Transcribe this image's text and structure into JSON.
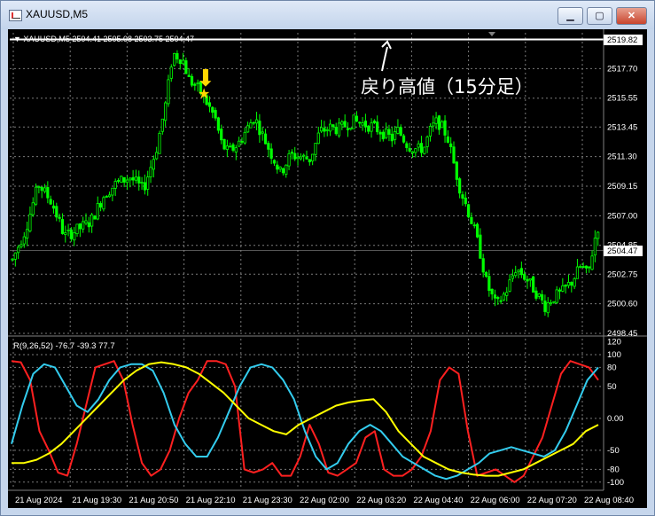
{
  "window": {
    "title": "XAUUSD,M5",
    "icon": "chart-window-icon",
    "minimize_label": "▁",
    "maximize_label": "▢",
    "close_label": "✕"
  },
  "chart_data": [
    {
      "type": "candlestick",
      "header": "▼ XAUUSD,M5  2504.41 2505.08 2503.75 2504.47",
      "symbol": "XAUUSD,M5",
      "ohlc": {
        "open": 2504.41,
        "high": 2505.08,
        "low": 2503.75,
        "close": 2504.47
      },
      "y_ticks": [
        "2517.70",
        "2515.55",
        "2513.45",
        "2511.30",
        "2509.15",
        "2507.00",
        "2504.85",
        "2502.75",
        "2500.60",
        "2498.45"
      ],
      "ylim": [
        2498.45,
        2520.3
      ],
      "x_ticks": [
        "21 Aug 2024",
        "21 Aug 19:30",
        "21 Aug 20:50",
        "21 Aug 22:10",
        "21 Aug 23:30",
        "22 Aug 02:00",
        "22 Aug 03:20",
        "22 Aug 04:40",
        "22 Aug 06:00",
        "22 Aug 07:20",
        "22 Aug 08:40"
      ],
      "grid": true,
      "bull_color": "#00ff00",
      "bear_color": "#00ff00",
      "background": "#000000",
      "close_path": [
        [
          0,
          2503.8
        ],
        [
          4,
          2506
        ],
        [
          8,
          2509.3
        ],
        [
          12,
          2508
        ],
        [
          16,
          2505.5
        ],
        [
          20,
          2506
        ],
        [
          24,
          2506.6
        ],
        [
          28,
          2508.5
        ],
        [
          32,
          2509.4
        ],
        [
          36,
          2509.8
        ],
        [
          40,
          2508.9
        ],
        [
          44,
          2511.8
        ],
        [
          47,
          2515.3
        ],
        [
          49,
          2518.8
        ],
        [
          52,
          2518.4
        ],
        [
          54,
          2516.9
        ],
        [
          57,
          2516.2
        ],
        [
          59,
          2515.4
        ],
        [
          62,
          2514.1
        ],
        [
          64,
          2512.2
        ],
        [
          66,
          2511.6
        ],
        [
          69,
          2512.2
        ],
        [
          72,
          2513.4
        ],
        [
          74,
          2514.2
        ],
        [
          77,
          2512.6
        ],
        [
          80,
          2511.1
        ],
        [
          82,
          2510.1
        ],
        [
          85,
          2511.4
        ],
        [
          88,
          2511.3
        ],
        [
          91,
          2511.1
        ],
        [
          94,
          2513.1
        ],
        [
          97,
          2513.4
        ],
        [
          100,
          2513.3
        ],
        [
          104,
          2513.9
        ],
        [
          107,
          2513.7
        ],
        [
          110,
          2513.5
        ],
        [
          113,
          2513.1
        ],
        [
          116,
          2512.6
        ],
        [
          118,
          2513.2
        ],
        [
          121,
          2512.1
        ],
        [
          124,
          2511.8
        ],
        [
          126,
          2512.0
        ],
        [
          128,
          2513.3
        ],
        [
          130,
          2513.9
        ],
        [
          133,
          2512.8
        ],
        [
          135,
          2510.8
        ],
        [
          137,
          2508.9
        ],
        [
          139,
          2507.6
        ],
        [
          141,
          2506.2
        ],
        [
          143,
          2504.4
        ],
        [
          145,
          2502.1
        ],
        [
          148,
          2500.4
        ],
        [
          151,
          2501.5
        ],
        [
          154,
          2503.2
        ],
        [
          157,
          2502.5
        ],
        [
          160,
          2501.5
        ],
        [
          163,
          2500.4
        ],
        [
          165,
          2501.0
        ],
        [
          168,
          2501.4
        ],
        [
          171,
          2502.2
        ],
        [
          174,
          2503.4
        ],
        [
          176,
          2502.6
        ],
        [
          178,
          2505.2
        ],
        [
          180,
          2507.0
        ]
      ],
      "resistance_value": 2519.82,
      "resistance_label": "2519.82",
      "current_price_label": "2504.47",
      "current_price": 2504.47,
      "annotation_text": "戻り高値（15分足）",
      "marker_arrow_color": "#ffd700",
      "marker_star": "★",
      "marker_arrow": "⬇"
    },
    {
      "type": "line",
      "header": "R(9,26,52) -76.7 -39.3 77.7",
      "indicator_name": "R(9,26,52)",
      "values_label": "-76.7 -39.3 77.7",
      "y_ticks": [
        "120",
        "100",
        "80",
        "50",
        "0.00",
        "-50",
        "-80",
        "-100"
      ],
      "ylim": [
        -110,
        125
      ],
      "series": [
        {
          "color": "#ff2020",
          "values": [
            90,
            88,
            60,
            -20,
            -50,
            -85,
            -90,
            -40,
            20,
            80,
            85,
            90,
            60,
            -10,
            -70,
            -90,
            -80,
            -50,
            0,
            40,
            60,
            90,
            90,
            85,
            50,
            -80,
            -85,
            -80,
            -70,
            -90,
            -90,
            -60,
            -10,
            -40,
            -85,
            -90,
            -80,
            -70,
            -30,
            -20,
            -80,
            -90,
            -90,
            -80,
            -60,
            -20,
            60,
            80,
            70,
            -20,
            -90,
            -85,
            -80,
            -90,
            -100,
            -90,
            -60,
            -30,
            20,
            70,
            90,
            85,
            80,
            60
          ]
        },
        {
          "color": "#33ccee",
          "values": [
            -40,
            20,
            70,
            85,
            80,
            50,
            20,
            10,
            30,
            60,
            80,
            85,
            85,
            75,
            40,
            -10,
            -40,
            -60,
            -60,
            -30,
            10,
            50,
            80,
            85,
            80,
            60,
            30,
            -20,
            -60,
            -80,
            -70,
            -40,
            -20,
            -10,
            -20,
            -40,
            -60,
            -70,
            -80,
            -90,
            -95,
            -90,
            -80,
            -70,
            -55,
            -50,
            -45,
            -50,
            -55,
            -60,
            -50,
            -20,
            20,
            60,
            80
          ]
        },
        {
          "color": "#ffff00",
          "values": [
            -70,
            -70,
            -65,
            -55,
            -40,
            -20,
            0,
            20,
            40,
            60,
            75,
            85,
            88,
            85,
            80,
            70,
            55,
            40,
            20,
            0,
            -10,
            -20,
            -25,
            -10,
            0,
            10,
            20,
            25,
            28,
            30,
            10,
            -20,
            -40,
            -60,
            -70,
            -80,
            -85,
            -88,
            -90,
            -90,
            -85,
            -80,
            -70,
            -60,
            -50,
            -40,
            -20,
            -10
          ]
        }
      ],
      "grid": true
    }
  ]
}
